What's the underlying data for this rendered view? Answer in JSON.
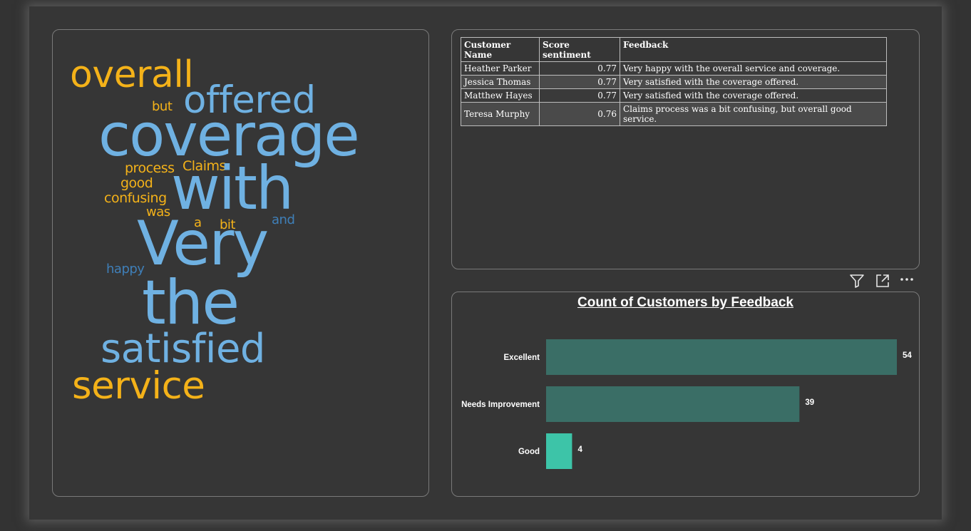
{
  "word_cloud": {
    "colors": {
      "blue_light": "#6fb1e2",
      "blue_dark": "#3f7fb8",
      "orange": "#f4b219"
    },
    "words": [
      {
        "text": "overall",
        "color": "orange"
      },
      {
        "text": "offered",
        "color": "blue_light"
      },
      {
        "text": "but",
        "color": "orange"
      },
      {
        "text": "coverage",
        "color": "blue_light"
      },
      {
        "text": "process",
        "color": "orange"
      },
      {
        "text": "Claims",
        "color": "orange"
      },
      {
        "text": "good",
        "color": "orange"
      },
      {
        "text": "with",
        "color": "blue_light"
      },
      {
        "text": "confusing",
        "color": "orange"
      },
      {
        "text": "was",
        "color": "orange"
      },
      {
        "text": "a",
        "color": "orange"
      },
      {
        "text": "bit",
        "color": "orange"
      },
      {
        "text": "and",
        "color": "blue_dark"
      },
      {
        "text": "Very",
        "color": "blue_light"
      },
      {
        "text": "happy",
        "color": "blue_dark"
      },
      {
        "text": "the",
        "color": "blue_light"
      },
      {
        "text": "satisfied",
        "color": "blue_light"
      },
      {
        "text": "service",
        "color": "orange"
      }
    ]
  },
  "table": {
    "headers": [
      "Customer Name",
      "Score sentiment",
      "Feedback"
    ],
    "rows": [
      [
        "Heather Parker",
        "0.77",
        "Very happy with the overall service and coverage."
      ],
      [
        "Jessica Thomas",
        "0.77",
        "Very satisfied with the coverage offered."
      ],
      [
        "Matthew Hayes",
        "0.77",
        "Very satisfied with the coverage offered."
      ],
      [
        "Teresa Murphy",
        "0.76",
        "Claims process was a bit confusing, but overall good service."
      ]
    ]
  },
  "visual_header_icons": [
    "filter-icon",
    "focus-mode-icon",
    "more-options-icon"
  ],
  "chart_data": {
    "type": "bar",
    "orientation": "horizontal",
    "title": "Count of Customers by Feedback",
    "categories": [
      "Excellent",
      "Needs Improvement",
      "Good"
    ],
    "values": [
      54,
      39,
      4
    ],
    "data_labels": [
      "54",
      "39",
      "4"
    ],
    "colors": [
      "#3a6e66",
      "#3a6e66",
      "#3dc4a8"
    ],
    "xlim": [
      0,
      54
    ]
  }
}
